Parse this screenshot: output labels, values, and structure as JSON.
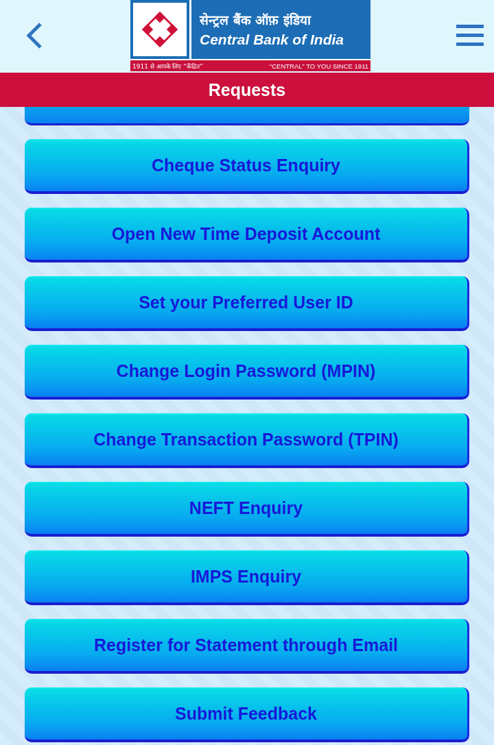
{
  "header": {
    "logo": {
      "hindi_name": "सेन्ट्रल बैंक ऑफ़ इंडिया",
      "english_name": "Central Bank of India",
      "tagline_hindi": "1911 से आपके लिए “केंद्रित”",
      "tagline_english": "“CENTRAL” TO YOU SINCE 1911"
    }
  },
  "title_bar": {
    "title": "Requests"
  },
  "buttons": [
    {
      "label": "Cheque Status Enquiry"
    },
    {
      "label": "Open New Time Deposit Account"
    },
    {
      "label": "Set your Preferred User ID"
    },
    {
      "label": "Change Login Password (MPIN)"
    },
    {
      "label": "Change Transaction Password (TPIN)"
    },
    {
      "label": "NEFT Enquiry"
    },
    {
      "label": "IMPS Enquiry"
    },
    {
      "label": "Register for Statement through Email"
    },
    {
      "label": "Submit Feedback"
    }
  ]
}
